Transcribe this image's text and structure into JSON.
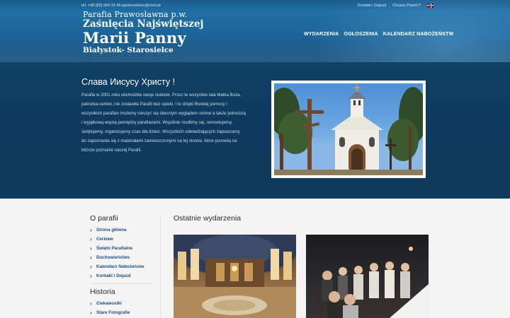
{
  "topbar": {
    "contact_line": "tel. +48 (85) 664 33 45 ppstarosielce@onet.pl",
    "links": [
      "Kontakt i Dojazd",
      "Chcesz Pomóc?"
    ],
    "language_icon": "uk-flag-icon"
  },
  "logo": {
    "line1": "Parafia Prawosławna  p.w.",
    "line2": "Zaśnięcia Najświętszej",
    "line3": "Marii Panny",
    "line4": "Białystok- Starosielce"
  },
  "nav": {
    "items": [
      "WYDARZENIA",
      "OGŁOSZENIA",
      "KALENDARZ NABOŻEŃSTW"
    ]
  },
  "hero": {
    "title": "Слава Иисусу Христу !",
    "body": "Parafia w 2001 roku obchodziła swoje stulecie. Przez te wszystkie lata Matka Boża, patronka cerkwi, nie zostawiła Parafii bez opieki. I to dzięki Boskiej pomocy i wszystkich parafian możemy cieszyć się obecnym wyglądem cerkwi a także jednością i wyjątkową więzią pomiędzy parafianami. Wspólnie modlimy się, remontujemy, świętujemy, organizujemy czas dla dzieci. Wszystkich odwiedzających zapraszamy do zapoznania się z materiałami zamieszczonymi na tej stronie, które pozwolą na bliższe poznanie naszej Parafii."
  },
  "sidebar": {
    "about_title": "O parafii",
    "about_items": [
      "Strona główna",
      "Cerkiew",
      "Święto Parafialne",
      "Duchowieństwo",
      "Kalendarz Nabożeństw",
      "Kontakt i Dojazd"
    ],
    "history_title": "Historia",
    "history_items": [
      "Ciekawostki",
      "Stare Fotografie"
    ]
  },
  "events": {
    "title": "Ostatnie wydarzenia"
  },
  "colors": {
    "header_blue": "#1c6396",
    "hero_navy": "#0e3a5c",
    "link_blue": "#1e4f7a"
  }
}
